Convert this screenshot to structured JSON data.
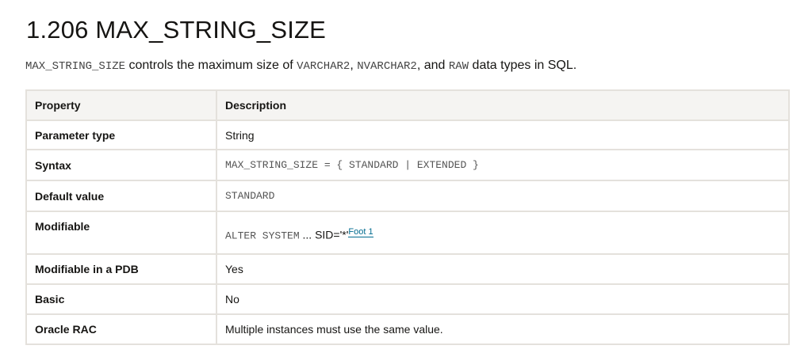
{
  "title": "1.206 MAX_STRING_SIZE",
  "intro": {
    "code1": "MAX_STRING_SIZE",
    "text1": " controls the maximum size of ",
    "code2": "VARCHAR2",
    "text2": ", ",
    "code3": "NVARCHAR2",
    "text3": ", and ",
    "code4": "RAW",
    "text4": " data types in SQL."
  },
  "table": {
    "headers": [
      "Property",
      "Description"
    ],
    "rows": [
      {
        "property": "Parameter type",
        "value": "String"
      },
      {
        "property": "Syntax",
        "value": "MAX_STRING_SIZE = { STANDARD | EXTENDED }"
      },
      {
        "property": "Default value",
        "value": "STANDARD"
      },
      {
        "property": "Modifiable",
        "value_code": "ALTER SYSTEM",
        "value_text": " ... SID='*'",
        "footnote": "Foot 1"
      },
      {
        "property": "Modifiable in a PDB",
        "value": "Yes"
      },
      {
        "property": "Basic",
        "value": "No"
      },
      {
        "property": "Oracle RAC",
        "value": "Multiple instances must use the same value."
      }
    ]
  }
}
